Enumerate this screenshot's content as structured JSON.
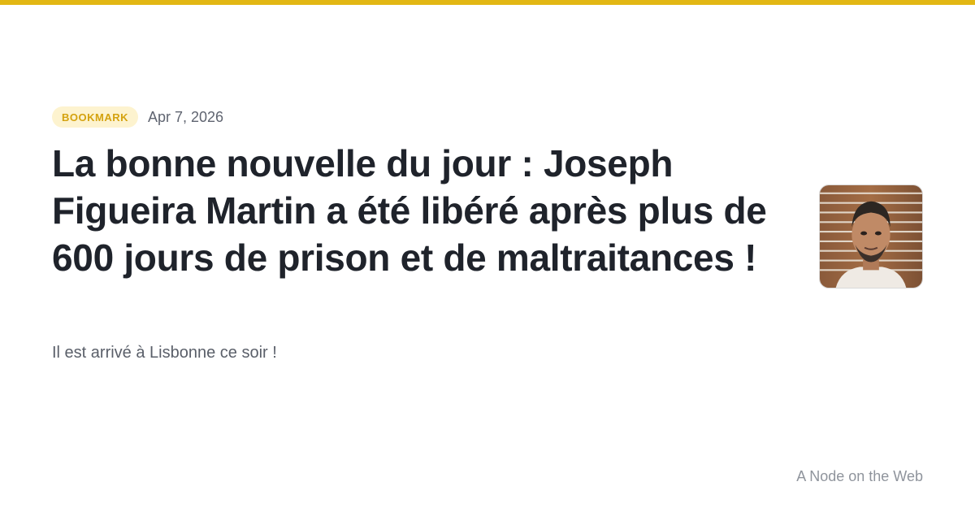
{
  "colors": {
    "accent": "#e2b714",
    "badge_bg": "#fdf3cf",
    "badge_text": "#d4a20f"
  },
  "post": {
    "badge": "BOOKMARK",
    "date": "Apr 7, 2026",
    "title": "La bonne nouvelle du jour : Joseph Figueira Martin a été libéré après plus de 600 jours de prison et de maltraitances !",
    "subtitle": "Il est arrivé à Lisbonne ce soir !"
  },
  "author": {
    "avatar_icon": "author-portrait"
  },
  "site": {
    "name": "A Node on the Web"
  }
}
